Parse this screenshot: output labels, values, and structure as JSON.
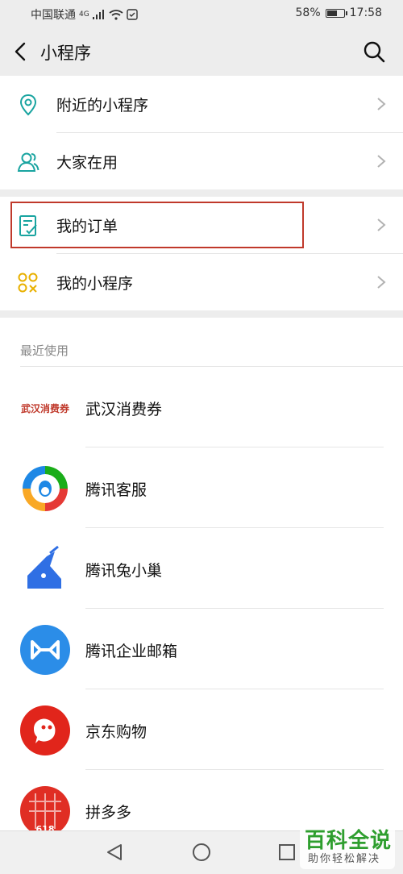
{
  "status_bar": {
    "carrier": "中国联通",
    "network": "4G",
    "battery": "58%",
    "battery_level": 0.58,
    "time": "17:58"
  },
  "nav": {
    "title": "小程序"
  },
  "menu_group_1": [
    {
      "label": "附近的小程序",
      "icon": "location-pin-icon"
    },
    {
      "label": "大家在用",
      "icon": "people-icon"
    }
  ],
  "menu_group_2": [
    {
      "label": "我的订单",
      "icon": "order-list-icon"
    },
    {
      "label": "我的小程序",
      "icon": "mini-program-icon"
    }
  ],
  "recent": {
    "header": "最近使用",
    "apps": [
      {
        "name": "武汉消费券",
        "logo_text": "武汉消费券",
        "icon": "wuhan-coupon-logo"
      },
      {
        "name": "腾讯客服",
        "icon": "tencent-service-logo"
      },
      {
        "name": "腾讯兔小巢",
        "icon": "tencent-rabbit-logo"
      },
      {
        "name": "腾讯企业邮箱",
        "icon": "tencent-mail-logo"
      },
      {
        "name": "京东购物",
        "icon": "jd-shopping-logo"
      },
      {
        "name": "拼多多",
        "logo_text": "618",
        "icon": "pinduoduo-logo"
      }
    ]
  },
  "watermark": {
    "main": "百科全说",
    "sub": "助你轻松解决"
  },
  "colors": {
    "accent_teal": "#19a4a0",
    "highlight_red": "#c0392b",
    "watermark_green": "#2e9e2e"
  }
}
